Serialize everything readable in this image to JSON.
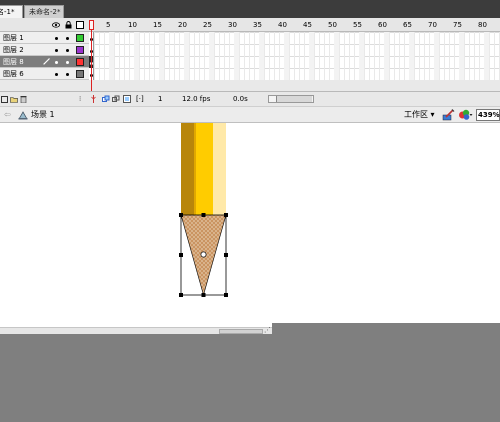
{
  "doc_tabs": [
    {
      "label": "名-1*",
      "active": true
    },
    {
      "label": "未命名-2*",
      "active": false
    }
  ],
  "timeline": {
    "header_icons": [
      "eye-icon",
      "lock-icon",
      "outline-icon"
    ],
    "ruler": [
      "1",
      "5",
      "10",
      "15",
      "20",
      "25",
      "30",
      "35",
      "40",
      "45",
      "50",
      "55",
      "60",
      "65",
      "70",
      "75",
      "80"
    ],
    "layers": [
      {
        "name": "图层 1",
        "color": "#33cc33",
        "selected": false
      },
      {
        "name": "图层 2",
        "color": "#9933cc",
        "selected": false
      },
      {
        "name": "图层 8",
        "color": "#ff3333",
        "selected": true
      },
      {
        "name": "图层 6",
        "color": "#777777",
        "selected": false
      }
    ],
    "footer": {
      "current_frame": "1",
      "fps": "12.0 fps",
      "time": "0.0s"
    }
  },
  "editbar": {
    "scene": "场景 1",
    "workspace": "工作区",
    "zoom": "439%"
  },
  "colors": {
    "pencil_dark": "#b8860b",
    "pencil_yellow": "#ffcc00",
    "pencil_light": "#ffe9a8",
    "tip": "#c8905c",
    "canvas_bg": "#7f7f7f"
  }
}
